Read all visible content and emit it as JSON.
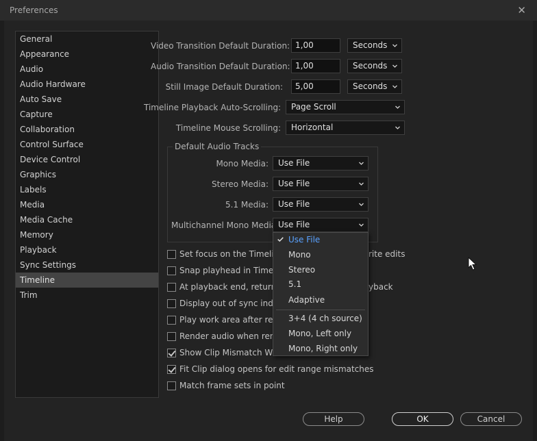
{
  "window": {
    "title": "Preferences",
    "close_glyph": "✕"
  },
  "sidebar": {
    "selected": "Timeline",
    "items": [
      "General",
      "Appearance",
      "Audio",
      "Audio Hardware",
      "Auto Save",
      "Capture",
      "Collaboration",
      "Control Surface",
      "Device Control",
      "Graphics",
      "Labels",
      "Media",
      "Media Cache",
      "Memory",
      "Playback",
      "Sync Settings",
      "Timeline",
      "Trim"
    ]
  },
  "durations": {
    "video": {
      "label": "Video Transition Default Duration:",
      "value": "1,00",
      "unit": "Seconds"
    },
    "audio": {
      "label": "Audio Transition Default Duration:",
      "value": "1,00",
      "unit": "Seconds"
    },
    "still": {
      "label": "Still Image Default Duration:",
      "value": "5,00",
      "unit": "Seconds"
    }
  },
  "scrolling": {
    "playback": {
      "label": "Timeline Playback Auto-Scrolling:",
      "value": "Page Scroll"
    },
    "mouse": {
      "label": "Timeline Mouse Scrolling:",
      "value": "Horizontal"
    }
  },
  "audio_tracks": {
    "title": "Default Audio Tracks",
    "mono": {
      "label": "Mono Media:",
      "value": "Use File"
    },
    "stereo": {
      "label": "Stereo Media:",
      "value": "Use File"
    },
    "five_one": {
      "label": "5.1 Media:",
      "value": "Use File"
    },
    "multichannel": {
      "label": "Multichannel Mono Media:",
      "value": "Use File"
    }
  },
  "dropdown": {
    "selected": "Use File",
    "options": [
      "Use File",
      "Mono",
      "Stereo",
      "5.1",
      "Adaptive",
      "3+4 (4 ch source)",
      "Mono, Left only",
      "Mono, Right only"
    ]
  },
  "options": [
    {
      "left": "Set focus on the Timeline w",
      "right": "rite edits",
      "checked": false
    },
    {
      "left": "Snap playhead in Timeline v",
      "right": "",
      "checked": false
    },
    {
      "left": "At playback end, return to b",
      "right": "yback",
      "checked": false
    },
    {
      "left": "Display out of sync indicato",
      "right": "",
      "checked": false
    },
    {
      "left": "Play work area after render",
      "right": "",
      "checked": false
    },
    {
      "left": "Render audio when renderir",
      "right": "",
      "checked": false
    },
    {
      "left": "Show Clip Mismatch Warnin",
      "right": "",
      "checked": true
    },
    {
      "left": "Fit Clip dialog opens for edit range mismatches",
      "right": "",
      "checked": true
    },
    {
      "left": "Match frame sets in point",
      "right": "",
      "checked": false
    }
  ],
  "buttons": {
    "help": "Help",
    "ok": "OK",
    "cancel": "Cancel"
  },
  "icons": {
    "close": "close-icon",
    "chevron": "chevron-down-icon",
    "check": "check-icon",
    "cursor": "mouse-pointer-icon"
  },
  "colors": {
    "selected_option": "#5aa2ff",
    "sidebar_selected": "#444444"
  }
}
